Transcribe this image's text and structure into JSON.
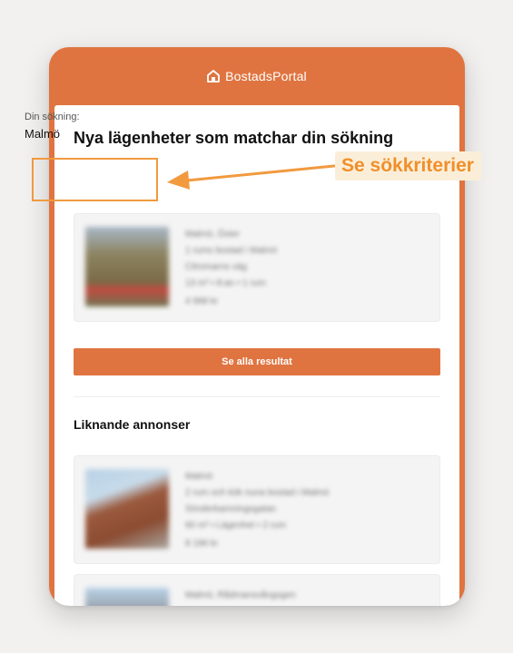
{
  "brand": {
    "name": "BostadsPortal",
    "icon": "house-icon",
    "color": "#e07440"
  },
  "main": {
    "title": "Nya lägenheter som matchar din sökning",
    "search": {
      "label": "Din sökning:",
      "value": "Malmö"
    },
    "results": [
      {
        "lines": [
          "Malmö, Öster",
          "1 rums bostad i Malmö",
          "Citromarns väg",
          "13 m² • 8:an • 1 rum",
          "4 998 kr"
        ]
      }
    ],
    "cta_label": "Se alla resultat"
  },
  "similar": {
    "title": "Liknande annonser",
    "items": [
      {
        "lines": [
          "Malmö",
          "2 rum och kök nuna bostad i Malmö",
          "Sönderkamningsgatan",
          "60 m² • Lägenhet • 2 rum",
          "8 196 kr"
        ]
      },
      {
        "lines": [
          "Malmö, Rådmansvångsgen"
        ]
      }
    ]
  },
  "annotation": {
    "text": "Se sökkriterier",
    "color": "#f19a3e"
  }
}
